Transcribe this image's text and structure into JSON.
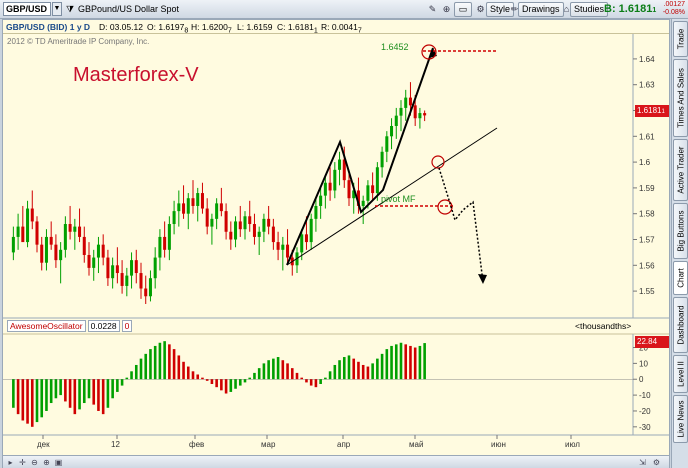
{
  "toolbar": {
    "symbol": "GBP/USD",
    "description": "GBPound/US Dollar Spot",
    "style_label": "Style",
    "drawings_label": "Drawings",
    "studies_label": "Studies",
    "bid_label": "B: 1.6181",
    "bid_suffix": "1",
    "change": ".00127",
    "change_pct": "-0.08%",
    "icons": [
      "filter-icon",
      "crosshair-icon",
      "zoom-icon",
      "pan-icon",
      "lock-icon",
      "chart-type-icon",
      "drawings-icon",
      "studies-icon"
    ]
  },
  "infobar": {
    "name": "GBP/USD (BID)  1 y D",
    "date": "D: 03.05.12",
    "open": "O: 1.6197",
    "open_sub": "8",
    "high": "H: 1.6200",
    "high_sub": "7",
    "low": "L: 1.6159",
    "close": "C: 1.6181",
    "close_sub": "1",
    "range": "R: 0.0041",
    "range_sub": "7"
  },
  "copyright": "2012 © TD Ameritrade IP Company, Inc.",
  "brand": "Masterforex-V",
  "price_tag": "1.6181",
  "price_tag_sub": "1",
  "annotations": {
    "target_label": "1.6452",
    "pivot_label": "pivot MF"
  },
  "price_axis": [
    "1.64",
    "1.63",
    "1.62",
    "1.61",
    "1.6",
    "1.59",
    "1.58",
    "1.57",
    "1.56",
    "1.55"
  ],
  "indicator": {
    "name": "AwesomeOscillator",
    "value": "0.0228",
    "extra": "0",
    "units": "<thousandths>",
    "tag": "22.84",
    "axis": [
      "20",
      "10",
      "0",
      "-10",
      "-20",
      "-30"
    ]
  },
  "time_axis": [
    "дек",
    "12",
    "фев",
    "мар",
    "апр",
    "май",
    "июн",
    "июл"
  ],
  "rail_tabs": [
    "Trade",
    "Times And Sales",
    "Active Trader",
    "Big Buttons",
    "Chart",
    "Dashboard",
    "Level II",
    "Live News"
  ],
  "colors": {
    "bull": "#00a000",
    "bear": "#d00000",
    "background": "#fffbe0",
    "brand": "#c8102e"
  },
  "chart_data": {
    "type": "candlestick",
    "y_range": [
      1.545,
      1.645
    ],
    "ao_range": [
      -32,
      26
    ],
    "candles": [
      [
        1.565,
        1.575,
        1.562,
        1.571
      ],
      [
        1.571,
        1.58,
        1.566,
        1.575
      ],
      [
        1.575,
        1.583,
        1.571,
        1.569
      ],
      [
        1.569,
        1.585,
        1.567,
        1.582
      ],
      [
        1.582,
        1.589,
        1.574,
        1.577
      ],
      [
        1.577,
        1.579,
        1.565,
        1.568
      ],
      [
        1.568,
        1.571,
        1.558,
        1.561
      ],
      [
        1.561,
        1.574,
        1.558,
        1.571
      ],
      [
        1.571,
        1.577,
        1.566,
        1.568
      ],
      [
        1.568,
        1.572,
        1.559,
        1.562
      ],
      [
        1.562,
        1.569,
        1.553,
        1.566
      ],
      [
        1.566,
        1.579,
        1.563,
        1.576
      ],
      [
        1.576,
        1.583,
        1.57,
        1.573
      ],
      [
        1.573,
        1.578,
        1.566,
        1.575
      ],
      [
        1.575,
        1.582,
        1.569,
        1.571
      ],
      [
        1.571,
        1.575,
        1.561,
        1.564
      ],
      [
        1.564,
        1.569,
        1.556,
        1.559
      ],
      [
        1.559,
        1.566,
        1.554,
        1.563
      ],
      [
        1.563,
        1.571,
        1.557,
        1.568
      ],
      [
        1.568,
        1.572,
        1.56,
        1.563
      ],
      [
        1.563,
        1.566,
        1.552,
        1.555
      ],
      [
        1.555,
        1.563,
        1.551,
        1.56
      ],
      [
        1.56,
        1.567,
        1.553,
        1.557
      ],
      [
        1.557,
        1.562,
        1.549,
        1.552
      ],
      [
        1.552,
        1.559,
        1.548,
        1.556
      ],
      [
        1.556,
        1.565,
        1.551,
        1.562
      ],
      [
        1.562,
        1.566,
        1.553,
        1.557
      ],
      [
        1.557,
        1.561,
        1.547,
        1.551
      ],
      [
        1.551,
        1.556,
        1.545,
        1.548
      ],
      [
        1.548,
        1.558,
        1.546,
        1.555
      ],
      [
        1.555,
        1.567,
        1.551,
        1.563
      ],
      [
        1.563,
        1.574,
        1.558,
        1.571
      ],
      [
        1.571,
        1.577,
        1.563,
        1.566
      ],
      [
        1.566,
        1.579,
        1.562,
        1.576
      ],
      [
        1.576,
        1.585,
        1.572,
        1.581
      ],
      [
        1.581,
        1.589,
        1.575,
        1.584
      ],
      [
        1.584,
        1.591,
        1.578,
        1.58
      ],
      [
        1.58,
        1.588,
        1.574,
        1.586
      ],
      [
        1.586,
        1.593,
        1.58,
        1.583
      ],
      [
        1.583,
        1.59,
        1.577,
        1.588
      ],
      [
        1.588,
        1.592,
        1.58,
        1.582
      ],
      [
        1.582,
        1.586,
        1.572,
        1.575
      ],
      [
        1.575,
        1.58,
        1.568,
        1.578
      ],
      [
        1.578,
        1.586,
        1.574,
        1.584
      ],
      [
        1.584,
        1.59,
        1.579,
        1.581
      ],
      [
        1.581,
        1.584,
        1.57,
        1.573
      ],
      [
        1.573,
        1.577,
        1.566,
        1.57
      ],
      [
        1.57,
        1.579,
        1.567,
        1.577
      ],
      [
        1.577,
        1.583,
        1.571,
        1.574
      ],
      [
        1.574,
        1.581,
        1.57,
        1.579
      ],
      [
        1.579,
        1.585,
        1.573,
        1.576
      ],
      [
        1.576,
        1.58,
        1.568,
        1.571
      ],
      [
        1.571,
        1.575,
        1.564,
        1.573
      ],
      [
        1.573,
        1.58,
        1.569,
        1.578
      ],
      [
        1.578,
        1.583,
        1.572,
        1.575
      ],
      [
        1.575,
        1.578,
        1.566,
        1.569
      ],
      [
        1.569,
        1.573,
        1.562,
        1.566
      ],
      [
        1.566,
        1.571,
        1.558,
        1.568
      ],
      [
        1.568,
        1.574,
        1.561,
        1.563
      ],
      [
        1.563,
        1.566,
        1.556,
        1.56
      ],
      [
        1.56,
        1.567,
        1.557,
        1.565
      ],
      [
        1.565,
        1.574,
        1.562,
        1.572
      ],
      [
        1.572,
        1.579,
        1.566,
        1.569
      ],
      [
        1.569,
        1.58,
        1.566,
        1.578
      ],
      [
        1.578,
        1.586,
        1.573,
        1.583
      ],
      [
        1.583,
        1.59,
        1.578,
        1.587
      ],
      [
        1.587,
        1.595,
        1.582,
        1.592
      ],
      [
        1.592,
        1.598,
        1.585,
        1.589
      ],
      [
        1.589,
        1.6,
        1.586,
        1.597
      ],
      [
        1.597,
        1.604,
        1.591,
        1.601
      ],
      [
        1.601,
        1.606,
        1.59,
        1.593
      ],
      [
        1.593,
        1.597,
        1.583,
        1.586
      ],
      [
        1.586,
        1.592,
        1.58,
        1.589
      ],
      [
        1.589,
        1.594,
        1.58,
        1.583
      ],
      [
        1.583,
        1.587,
        1.576,
        1.585
      ],
      [
        1.585,
        1.593,
        1.582,
        1.591
      ],
      [
        1.591,
        1.596,
        1.585,
        1.588
      ],
      [
        1.588,
        1.6,
        1.585,
        1.598
      ],
      [
        1.598,
        1.606,
        1.594,
        1.604
      ],
      [
        1.604,
        1.612,
        1.6,
        1.61
      ],
      [
        1.61,
        1.617,
        1.605,
        1.614
      ],
      [
        1.614,
        1.621,
        1.609,
        1.618
      ],
      [
        1.618,
        1.624,
        1.612,
        1.621
      ],
      [
        1.621,
        1.628,
        1.616,
        1.625
      ],
      [
        1.625,
        1.631,
        1.618,
        1.622
      ],
      [
        1.622,
        1.626,
        1.614,
        1.617
      ],
      [
        1.617,
        1.621,
        1.613,
        1.619
      ],
      [
        1.619,
        1.62,
        1.6159,
        1.6181
      ]
    ],
    "ao": [
      -18,
      -22,
      -26,
      -28,
      -30,
      -27,
      -24,
      -20,
      -15,
      -12,
      -10,
      -14,
      -18,
      -22,
      -19,
      -15,
      -12,
      -16,
      -20,
      -22,
      -18,
      -12,
      -8,
      -4,
      1,
      5,
      9,
      13,
      16,
      19,
      21,
      23,
      24,
      22,
      19,
      15,
      11,
      8,
      5,
      3,
      1,
      -1,
      -3,
      -5,
      -7,
      -9,
      -8,
      -6,
      -4,
      -2,
      1,
      4,
      7,
      10,
      12,
      13,
      14,
      12,
      10,
      7,
      4,
      1,
      -2,
      -4,
      -5,
      -3,
      1,
      5,
      9,
      12,
      14,
      15,
      13,
      11,
      9,
      8,
      10,
      13,
      16,
      19,
      21,
      22,
      23,
      22,
      21,
      20,
      21,
      22.8
    ]
  }
}
